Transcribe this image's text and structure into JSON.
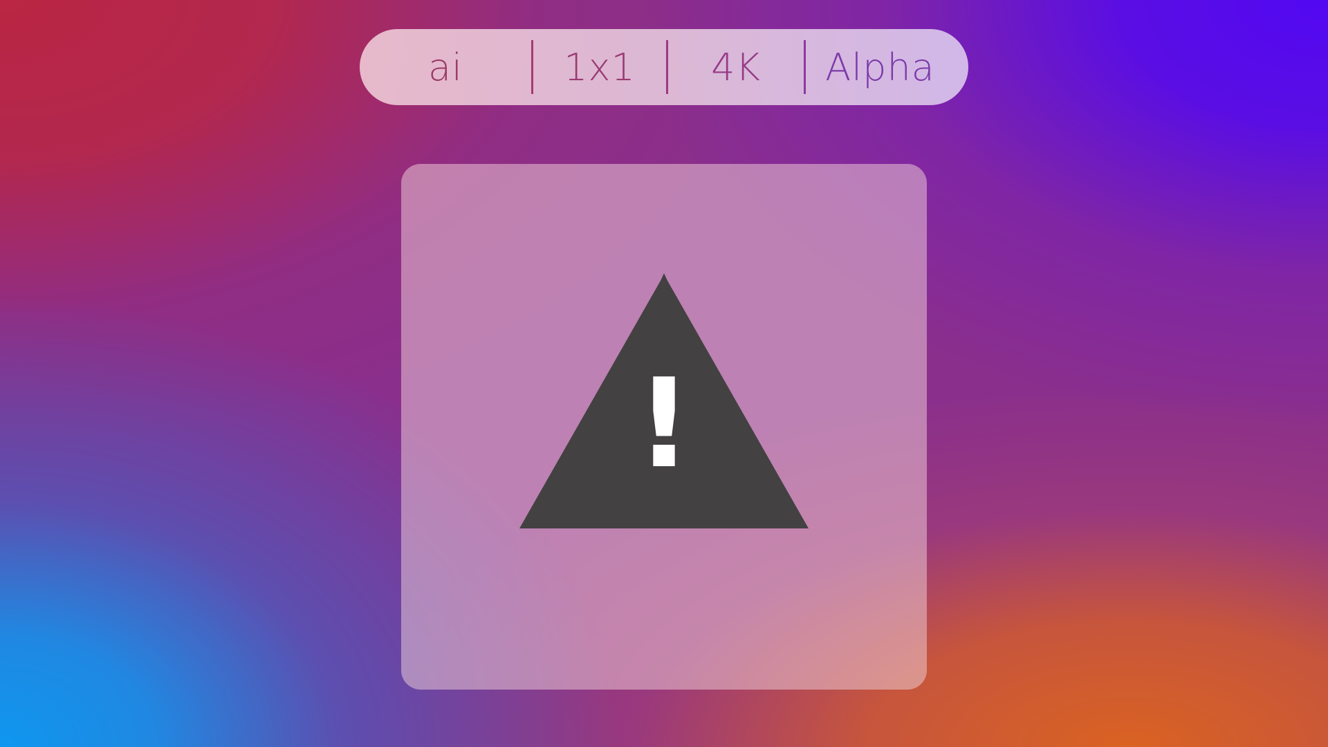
{
  "tags": {
    "ai": "ai",
    "ratio": "1x1",
    "resolution": "4K",
    "alpha": "Alpha"
  },
  "card": {
    "icon": "warning-icon",
    "icon_glyph": "!"
  },
  "colors": {
    "triangle": "#434142",
    "glyph": "#ffffff",
    "tag_text_left": "#9a3a66",
    "tag_text_right": "#7c3aa8",
    "background_top_left": "#ba2643",
    "background_top_right": "#5208f2",
    "background_bottom_left": "#0e97f0",
    "background_bottom_right": "#da6222"
  }
}
